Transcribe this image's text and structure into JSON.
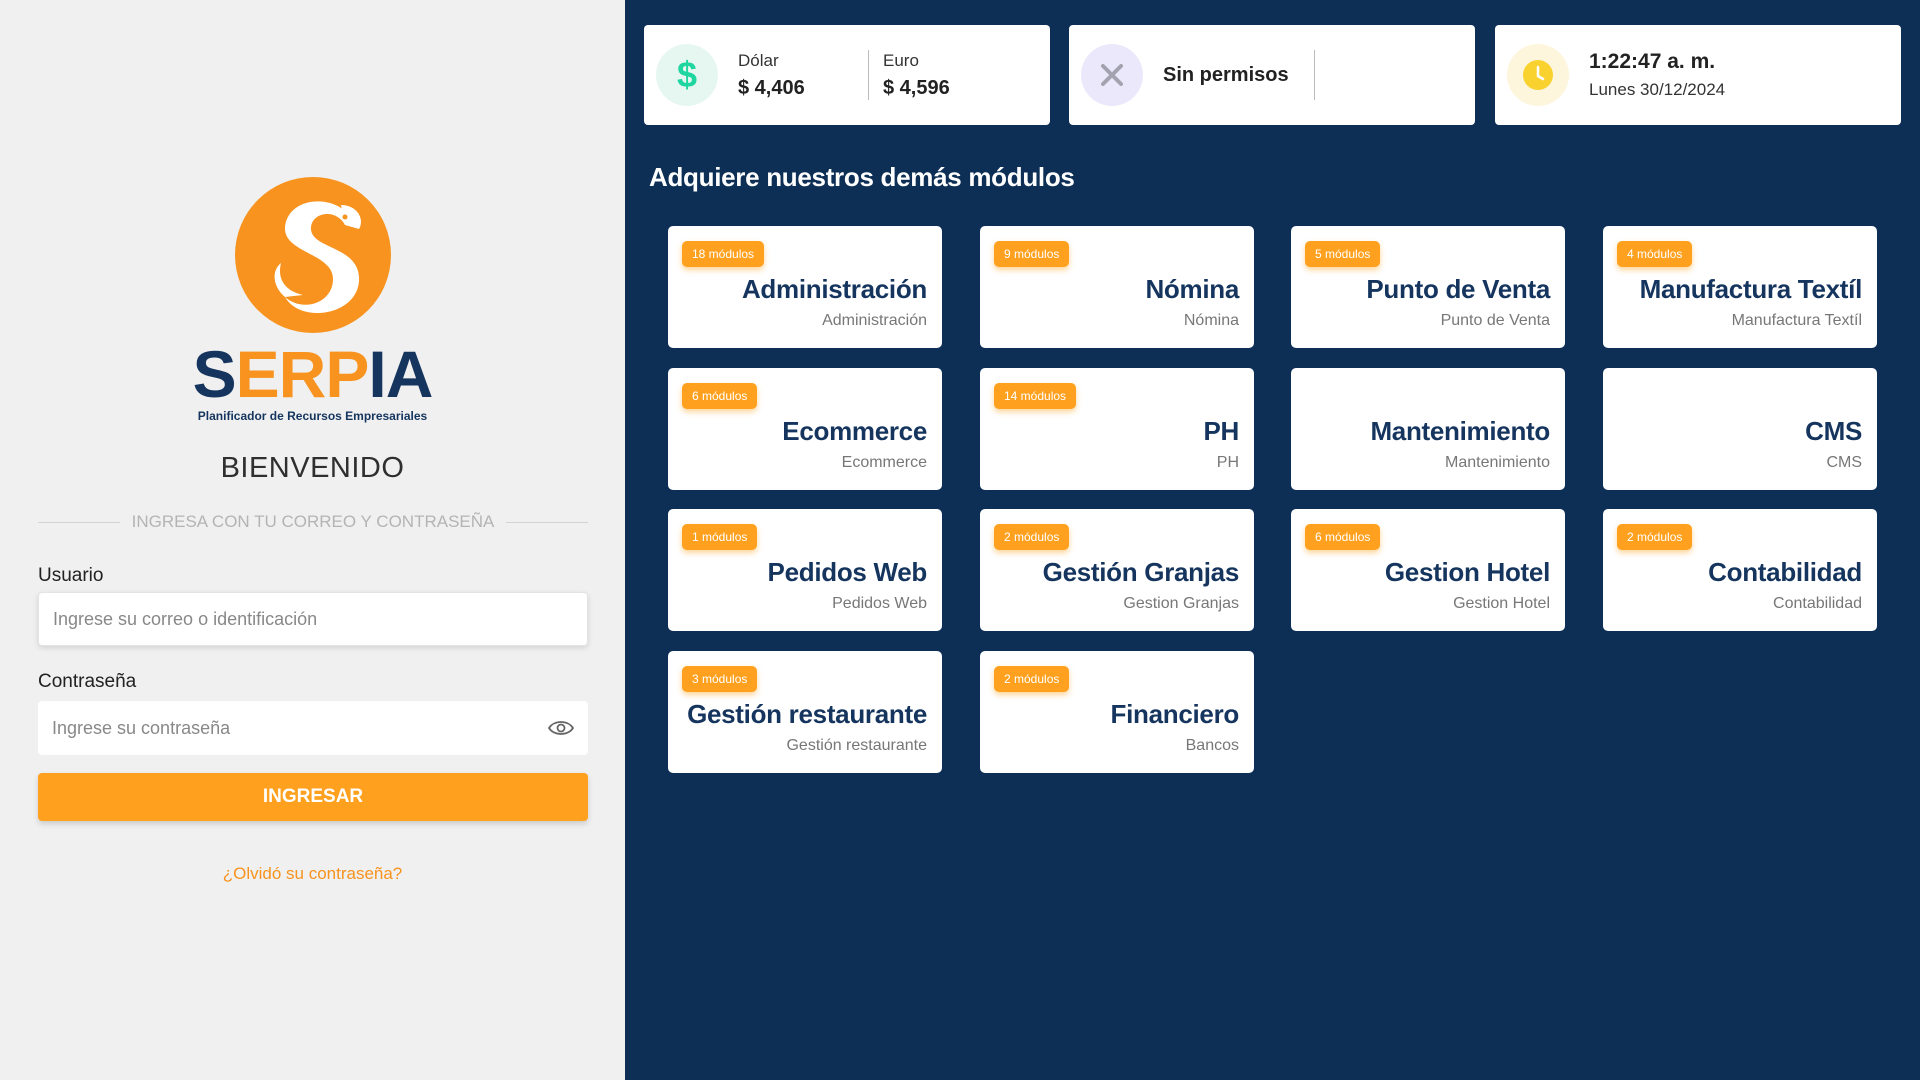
{
  "login": {
    "brand_part1": "S",
    "brand_part2": "ERP",
    "brand_part3": "IA",
    "tagline": "Planificador de Recursos Empresariales",
    "welcome": "BIENVENIDO",
    "subtitle": "INGRESA CON TU CORREO Y CONTRASEÑA",
    "user_label": "Usuario",
    "user_placeholder": "Ingrese su correo o identificación",
    "password_label": "Contraseña",
    "password_placeholder": "Ingrese su contraseña",
    "submit_label": "INGRESAR",
    "forgot_label": "¿Olvidó su contraseña?"
  },
  "header": {
    "currency": {
      "icon": "dollar-icon",
      "dollar_label": "Dólar",
      "dollar_value": "$ 4,406",
      "euro_label": "Euro",
      "euro_value": "$ 4,596"
    },
    "permissions": {
      "icon": "close-icon",
      "text": "Sin permisos"
    },
    "clock": {
      "icon": "clock-icon",
      "time": "1:22:47 a. m.",
      "date": "Lunes 30/12/2024"
    }
  },
  "modules_title": "Adquiere nuestros demás módulos",
  "modules": [
    {
      "badge": "18 módulos",
      "name": "Administración",
      "sub": "Administración"
    },
    {
      "badge": "9 módulos",
      "name": "Nómina",
      "sub": "Nómina"
    },
    {
      "badge": "5 módulos",
      "name": "Punto de Venta",
      "sub": "Punto de Venta"
    },
    {
      "badge": "4 módulos",
      "name": "Manufactura Textíl",
      "sub": "Manufactura Textíl"
    },
    {
      "badge": "6 módulos",
      "name": "Ecommerce",
      "sub": "Ecommerce"
    },
    {
      "badge": "14 módulos",
      "name": "PH",
      "sub": "PH"
    },
    {
      "badge": "",
      "name": "Mantenimiento",
      "sub": "Mantenimiento"
    },
    {
      "badge": "",
      "name": "CMS",
      "sub": "CMS"
    },
    {
      "badge": "1 módulos",
      "name": "Pedidos Web",
      "sub": "Pedidos Web"
    },
    {
      "badge": "2 módulos",
      "name": "Gestión Granjas",
      "sub": "Gestion Granjas"
    },
    {
      "badge": "6 módulos",
      "name": "Gestion Hotel",
      "sub": "Gestion Hotel"
    },
    {
      "badge": "2 módulos",
      "name": "Contabilidad",
      "sub": "Contabilidad"
    },
    {
      "badge": "3 módulos",
      "name": "Gestión restaurante",
      "sub": "Gestión restaurante"
    },
    {
      "badge": "2 módulos",
      "name": "Financiero",
      "sub": "Bancos"
    }
  ],
  "colors": {
    "accent": "#ffa11f",
    "navy": "#0e2f55",
    "brand_dark": "#15355e",
    "brand_orange": "#f7931e"
  }
}
